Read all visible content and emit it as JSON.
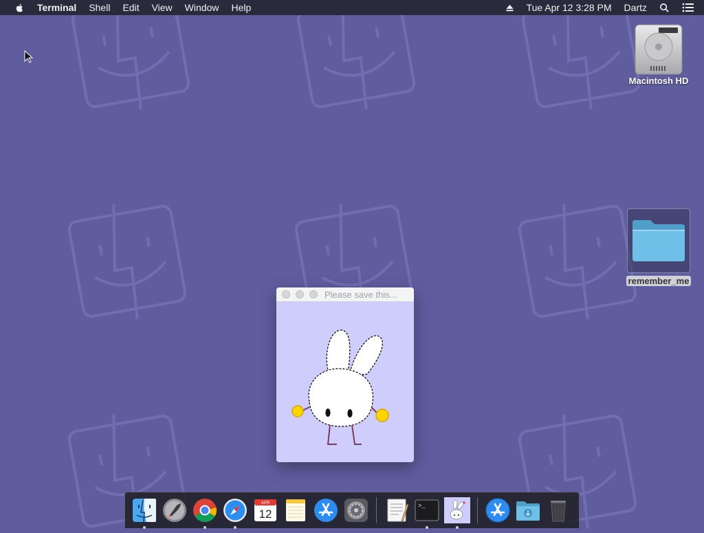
{
  "menubar": {
    "app_name": "Terminal",
    "items": [
      "Shell",
      "Edit",
      "View",
      "Window",
      "Help"
    ],
    "datetime": "Tue Apr 12  3:28 PM",
    "user": "Dartz"
  },
  "desktop": {
    "hd_label": "Macintosh HD",
    "folder_label": "remember_me"
  },
  "window": {
    "title": "Please save this..."
  },
  "dock": {
    "calendar_month": "APR",
    "calendar_day": "12",
    "terminal_prompt": ">_",
    "apps": [
      "Finder",
      "Launchpad",
      "Google Chrome",
      "Safari",
      "Calendar",
      "Notes",
      "App Store",
      "System Preferences",
      "TextEdit",
      "Terminal",
      "Please save this",
      "Applications",
      "Downloads",
      "Trash"
    ]
  },
  "colors": {
    "wallpaper": "#5f5d9e",
    "menubar": "#2b2a3c",
    "window_bg": "#cfcdfb"
  }
}
